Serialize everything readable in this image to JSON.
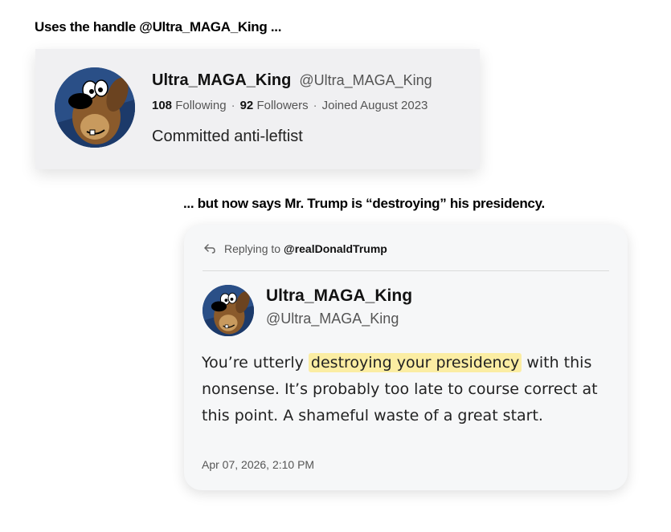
{
  "captions": {
    "top": "Uses the handle @Ultra_MAGA_King ...",
    "middle": "... but now says Mr. Trump is “destroying” his presidency."
  },
  "profile": {
    "name": "Ultra_MAGA_King",
    "handle": "@Ultra_MAGA_King",
    "following_count": "108",
    "following_label": "Following",
    "followers_count": "92",
    "followers_label": "Followers",
    "joined": "Joined August 2023",
    "bio": "Committed anti-leftist",
    "avatar_icon": "cartoon-dog-avatar"
  },
  "tweet": {
    "reply_prefix": "Replying to",
    "reply_handle": "@realDonaldTrump",
    "name": "Ultra_MAGA_King",
    "handle": "@Ultra_MAGA_King",
    "text_before": "You’re utterly ",
    "text_highlight": "destroying your presidency",
    "text_after": " with this nonsense. It’s probably too late to course correct at this point. A shameful waste of a great start.",
    "timestamp": "Apr 07, 2026, 2:10 PM",
    "highlight_color": "#fbeda3"
  }
}
